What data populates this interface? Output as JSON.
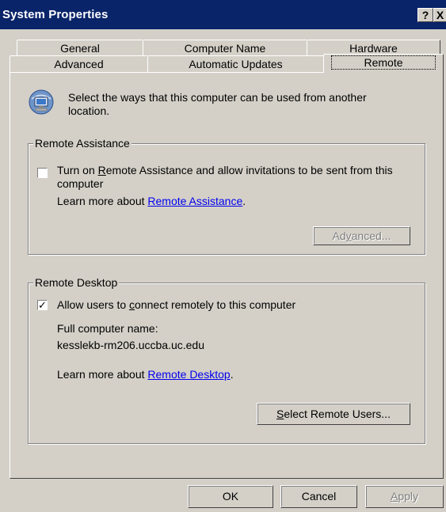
{
  "window": {
    "title": "System Properties",
    "help_glyph": "?",
    "close_glyph": "X"
  },
  "tabs": {
    "back_row": [
      "General",
      "Computer Name",
      "Hardware"
    ],
    "front_row": [
      "Advanced",
      "Automatic Updates",
      "Remote"
    ],
    "selected": "Remote"
  },
  "intro": {
    "text": "Select the ways that this computer can be used from another location.",
    "icon": "computer-network-icon"
  },
  "remote_assistance": {
    "group_title": "Remote Assistance",
    "checkbox_label_pre": "Turn on ",
    "checkbox_label_acc": "R",
    "checkbox_label_post": "emote Assistance and allow invitations to be sent from this computer",
    "checked": false,
    "learn_more_prefix": "Learn more about ",
    "learn_more_link": "Remote Assistance",
    "learn_more_suffix": ".",
    "advanced_pre": "Ad",
    "advanced_acc": "v",
    "advanced_post": "anced..."
  },
  "remote_desktop": {
    "group_title": "Remote Desktop",
    "checkbox_label_pre": "Allow users to ",
    "checkbox_label_acc": "c",
    "checkbox_label_post": "onnect remotely to this computer",
    "checked": true,
    "check_glyph": "✓",
    "full_name_label": "Full computer name:",
    "full_name_value": "kesslekb-rm206.uccba.uc.edu",
    "learn_more_prefix": "Learn more about ",
    "learn_more_link": "Remote Desktop",
    "learn_more_suffix": ".",
    "select_users_acc": "S",
    "select_users_post": "elect Remote Users..."
  },
  "footer": {
    "ok": "OK",
    "cancel": "Cancel",
    "apply_acc": "A",
    "apply_post": "pply"
  }
}
